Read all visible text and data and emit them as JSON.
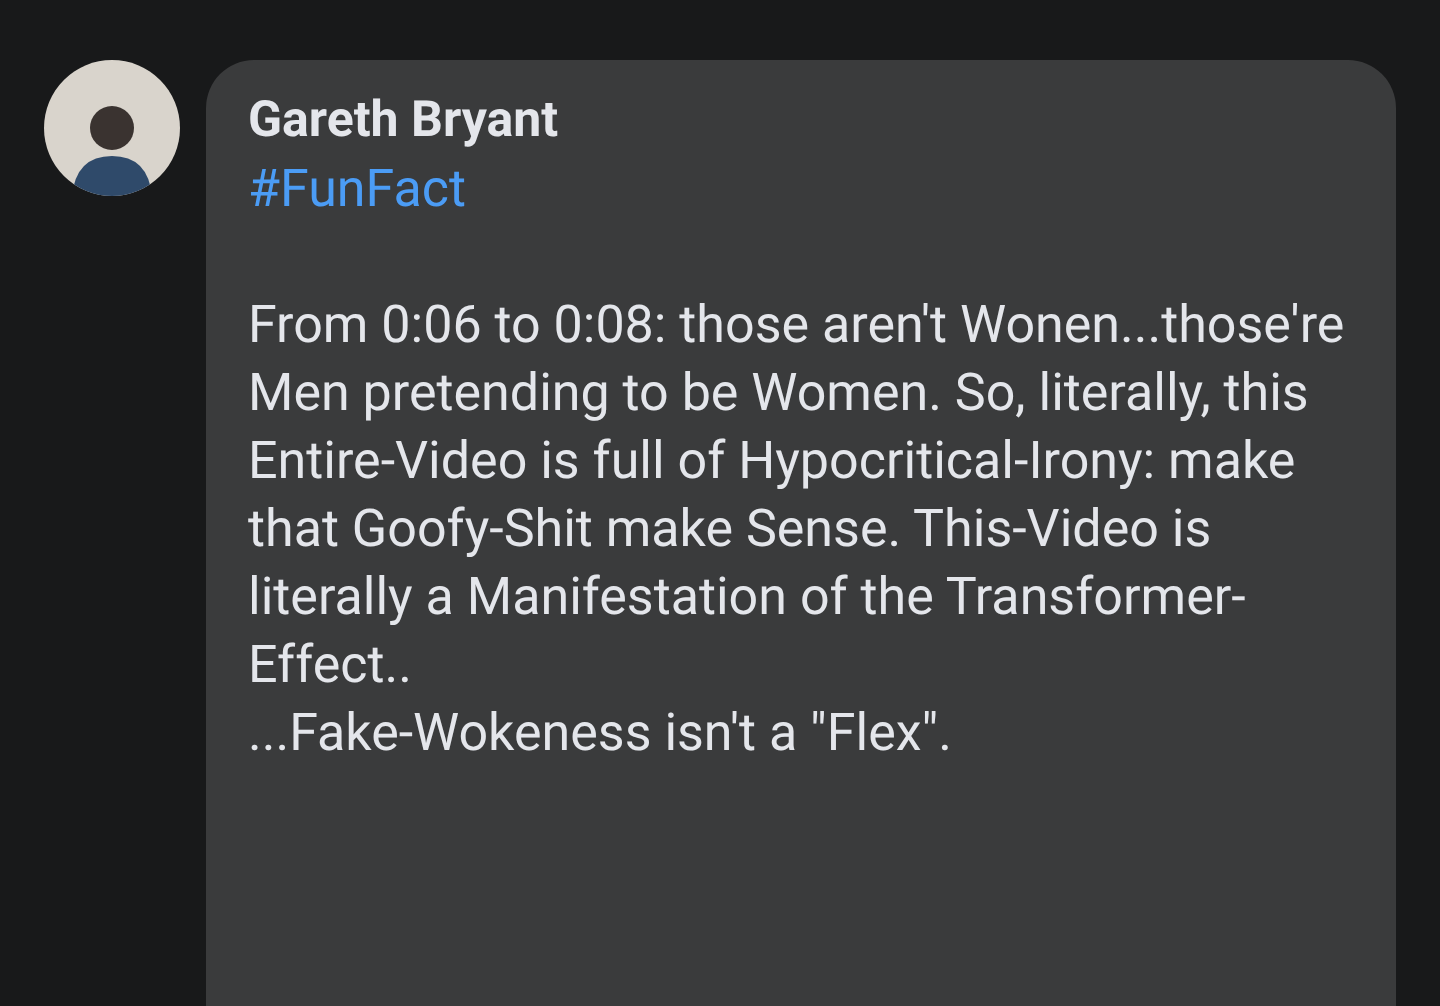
{
  "comment": {
    "author": "Gareth Bryant",
    "hashtag": "#FunFact",
    "paragraphs": [
      "From 0:06 to 0:08: those aren't Wonen...those're Men pretending to be Women. So, literally, this Entire-Video is full of Hypocritical-Irony: make that Goofy-Shit make Sense. This-Video is literally a Manifestation of the Transformer-Effect..",
      "...Fake-Wokeness isn't a \"Flex\"."
    ]
  }
}
